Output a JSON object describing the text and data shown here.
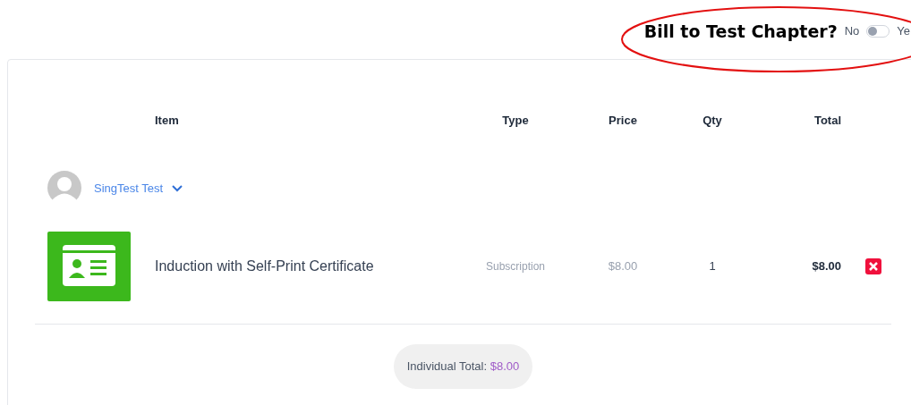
{
  "bill_to": {
    "label": "Bill to Test Chapter?",
    "off_label": "No",
    "on_label": "Ye",
    "on": false
  },
  "table": {
    "columns": [
      "Item",
      "Type",
      "Price",
      "Qty",
      "Total"
    ],
    "member": {
      "name": "SingTest Test"
    },
    "rows": [
      {
        "name": "Induction with Self-Print Certificate",
        "type": "Subscription",
        "price": "$8.00",
        "qty": "1",
        "total": "$8.00"
      }
    ],
    "individual_total": {
      "label": "Individual Total:",
      "value": "$8.00"
    }
  }
}
